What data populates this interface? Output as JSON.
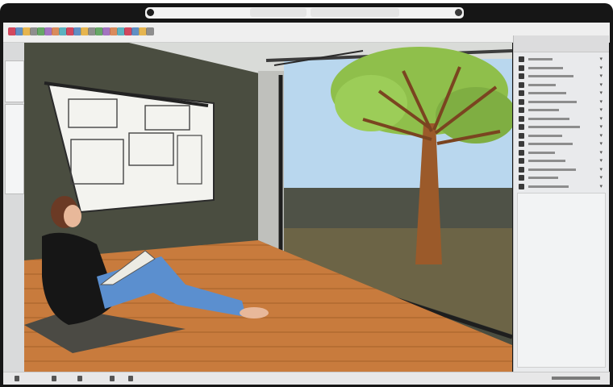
{
  "window": {
    "title": ""
  },
  "toolbar": {
    "brand": "",
    "icons": [
      "select-tool-icon",
      "eraser-tool-icon",
      "pencil-tool-icon",
      "arc-tool-icon",
      "shape-tool-icon",
      "push-pull-icon",
      "move-tool-icon",
      "rotate-tool-icon",
      "scale-tool-icon",
      "offset-tool-icon",
      "tape-measure-icon",
      "dimension-icon",
      "protractor-icon",
      "text-tool-icon",
      "axes-icon",
      "paint-bucket-icon",
      "orbit-icon",
      "pan-icon",
      "zoom-icon",
      "zoom-extents-icon"
    ]
  },
  "right_panel": {
    "title": "",
    "rows": 16
  },
  "statusbar": {
    "text": ""
  },
  "colors": {
    "frame": "#161616",
    "toolbar": "#efefef",
    "panel": "#e9eaec",
    "wall": "#4a4d40",
    "floor": "#c87b3d",
    "sky": "#b9d7ee",
    "grass": "#6c6446",
    "tree_canopy": "#8fbf4b",
    "tree_trunk": "#9b5a2a",
    "brand": "#b52d1e"
  },
  "scene": {
    "icons": [
      "drawing-board-icon",
      "person-reading-icon",
      "tree-icon",
      "sliding-door-icon"
    ]
  }
}
